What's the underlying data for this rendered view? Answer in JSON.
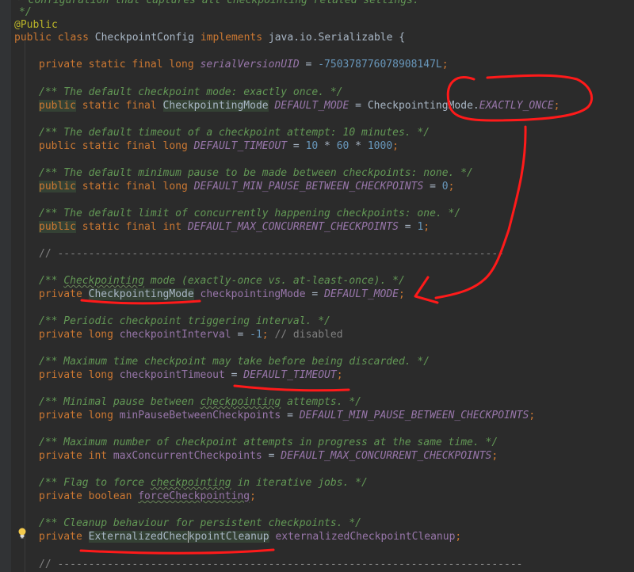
{
  "code": {
    "l0": "* Configuration that captures all checkpointing related settings.",
    "l1": "*/",
    "l2_ann": "@Public",
    "l3_a": "public class ",
    "l3_b": "CheckpointConfig ",
    "l3_c": "implements ",
    "l3_d": "java.io.Serializable {",
    "l4_a": "private static final long ",
    "l4_b": "serialVersionUID",
    "l4_c": " = ",
    "l4_d": "-750378776078908147L",
    "l4_e": ";",
    "c1": "/** The default checkpoint mode: exactly once. */",
    "l5_a": "public",
    "l5_b": " static final ",
    "l5_c": "CheckpointingMode",
    "l5_d": " ",
    "l5_e": "DEFAULT_MODE",
    "l5_f": " = CheckpointingMode.",
    "l5_g": "EXACTLY_ONCE",
    "l5_h": ";",
    "c2": "/** The default timeout of a checkpoint attempt: 10 minutes. */",
    "l6_a": "public static final long ",
    "l6_b": "DEFAULT_TIMEOUT",
    "l6_c": " = ",
    "l6_d": "10",
    "l6_e": " * ",
    "l6_f": "60",
    "l6_g": " * ",
    "l6_h": "1000",
    "l6_i": ";",
    "c3": "/** The default minimum pause to be made between checkpoints: none. */",
    "l7_a": "public",
    "l7_b": " static final long ",
    "l7_c": "DEFAULT_MIN_PAUSE_BETWEEN_CHECKPOINTS",
    "l7_d": " = ",
    "l7_e": "0",
    "l7_f": ";",
    "c4": "/** The default limit of concurrently happening checkpoints: one. */",
    "l8_a": "public",
    "l8_b": " static final int ",
    "l8_c": "DEFAULT_MAX_CONCURRENT_CHECKPOINTS",
    "l8_d": " = ",
    "l8_e": "1",
    "l8_f": ";",
    "sep": "// ------------------------------------------------------------------------",
    "c5_a": "/** ",
    "c5_b": "Checkpointing",
    "c5_c": " mode (exactly-once vs. at-least-once). */",
    "l9_a": "private ",
    "l9_b": "CheckpointingMode",
    "l9_c": " ",
    "l9_d": "checkpointingMode",
    "l9_e": " = ",
    "l9_f": "DEFAULT_MODE",
    "l9_g": ";",
    "c6": "/** Periodic checkpoint triggering interval. */",
    "l10_a": "private long ",
    "l10_b": "checkpointInterval",
    "l10_c": " = ",
    "l10_d": "-1",
    "l10_e": "; ",
    "l10_f": "// disabled",
    "c7": "/** Maximum time checkpoint may take before being discarded. */",
    "l11_a": "private long ",
    "l11_b": "checkpointTimeout",
    "l11_c": " = ",
    "l11_d": "DEFAULT_TIMEOUT",
    "l11_e": ";",
    "c8_a": "/** Minimal pause between ",
    "c8_b": "checkpointing",
    "c8_c": " attempts. */",
    "l12_a": "private long ",
    "l12_b": "minPauseBetweenCheckpoints",
    "l12_c": " = ",
    "l12_d": "DEFAULT_MIN_PAUSE_BETWEEN_CHECKPOINTS",
    "l12_e": ";",
    "c9": "/** Maximum number of checkpoint attempts in progress at the same time. */",
    "l13_a": "private int ",
    "l13_b": "maxConcurrentCheckpoints",
    "l13_c": " = ",
    "l13_d": "DEFAULT_MAX_CONCURRENT_CHECKPOINTS",
    "l13_e": ";",
    "c10_a": "/** Flag to force ",
    "c10_b": "checkpointing",
    "c10_c": " in iterative jobs. */",
    "l14_a": "private boolean ",
    "l14_b": "forceCheckpointing",
    "l14_c": ";",
    "c11": "/** Cleanup behaviour for persistent checkpoints. */",
    "l15_a": "private ",
    "l15_b1": "ExternalizedChec",
    "l15_b2": "kpointCleanup",
    "l15_c": " ",
    "l15_d": "externalizedCheckpointCleanup",
    "l15_e": ";",
    "sep2": "// ---------------------------------------------------------------------------"
  },
  "colors": {
    "background": "#2b2b2b",
    "keyword": "#cc7832",
    "comment": "#629755",
    "constant": "#9876aa",
    "number": "#6897bb",
    "annotation": "#bbb529",
    "pen": "#ff1a1a"
  },
  "icons": {
    "bulb": "lightbulb-icon"
  }
}
